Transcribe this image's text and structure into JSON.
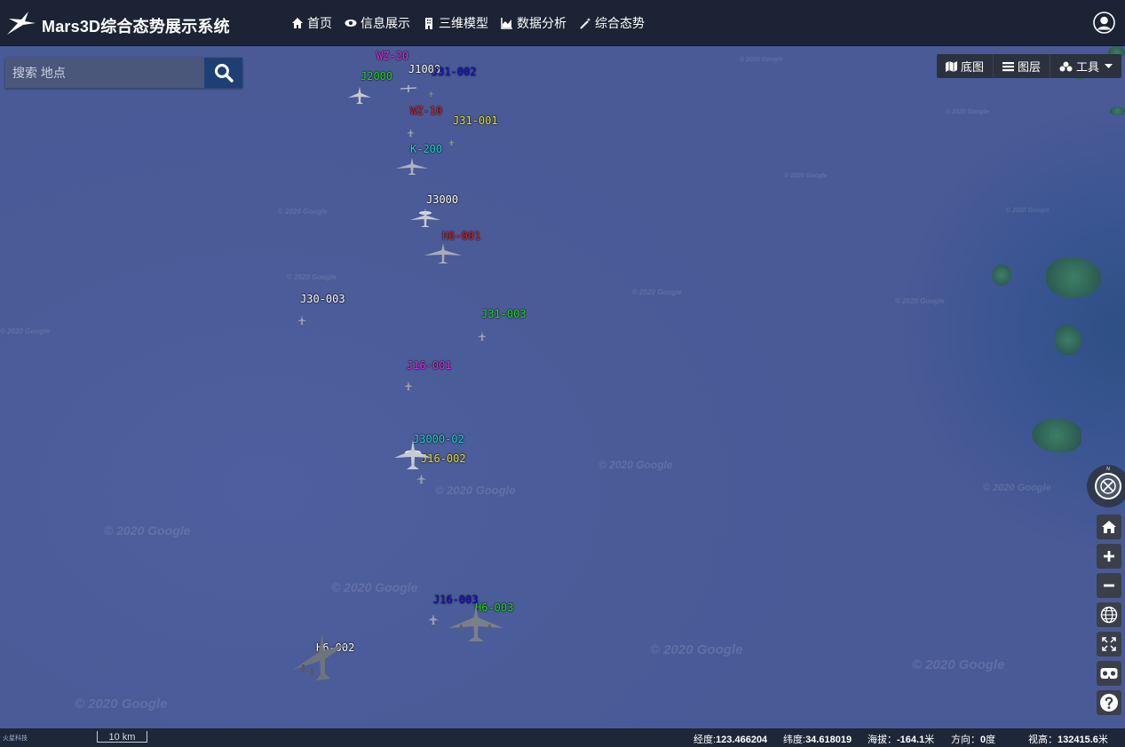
{
  "app": {
    "title": "Mars3D综合态势展示系统"
  },
  "nav": {
    "items": [
      {
        "label": "首页",
        "icon": "home-icon"
      },
      {
        "label": "信息展示",
        "icon": "eye-icon"
      },
      {
        "label": "三维模型",
        "icon": "building-icon"
      },
      {
        "label": "数据分析",
        "icon": "area-chart-icon"
      },
      {
        "label": "综合态势",
        "icon": "magic-wand-icon"
      }
    ]
  },
  "search": {
    "placeholder": "搜索 地点",
    "value": ""
  },
  "toolbar": {
    "basemap_label": "底图",
    "layers_label": "图层",
    "tools_label": "工具"
  },
  "aircraft": [
    {
      "name": "WZ-20",
      "color": "#e02ee0"
    },
    {
      "name": "J1000",
      "color": "#ffffff"
    },
    {
      "name": "J31-002",
      "color": "#1616c8"
    },
    {
      "name": "J2000",
      "color": "#22d822"
    },
    {
      "name": "WZ-10",
      "color": "#e02020"
    },
    {
      "name": "J31-001",
      "color": "#e8e020"
    },
    {
      "name": "K-200",
      "color": "#22d4d4"
    },
    {
      "name": "J3000",
      "color": "#ffffff"
    },
    {
      "name": "H6-001",
      "color": "#e02020"
    },
    {
      "name": "J30-003",
      "color": "#ffffff"
    },
    {
      "name": "J31-003",
      "color": "#22d822"
    },
    {
      "name": "J16-001",
      "color": "#e02ee0"
    },
    {
      "name": "J3000-02",
      "color": "#22d4d4"
    },
    {
      "name": "J16-002",
      "color": "#e8e020"
    },
    {
      "name": "J16-003",
      "color": "#1616c8"
    },
    {
      "name": "H6-003",
      "color": "#22d822"
    },
    {
      "name": "H6-002",
      "color": "#ffffff"
    }
  ],
  "watermark_text": "© 2020 Google",
  "status": {
    "brand": "火星科技",
    "scale": "10 km",
    "lon_label": "经度:",
    "lon_value": "123.466204",
    "lat_label": "纬度:",
    "lat_value": "34.618019",
    "alt_label": "海拔：",
    "alt_value": "-164.1",
    "alt_unit": "米",
    "heading_label": "方向：",
    "heading_value": "0",
    "heading_unit": "度",
    "view_label": "视高：",
    "view_value": "132415.6",
    "view_unit": "米"
  },
  "colors": {
    "header_bg": "#1b2334",
    "ocean": "#4a5a98",
    "statusbar_bg": "#1d2738"
  }
}
